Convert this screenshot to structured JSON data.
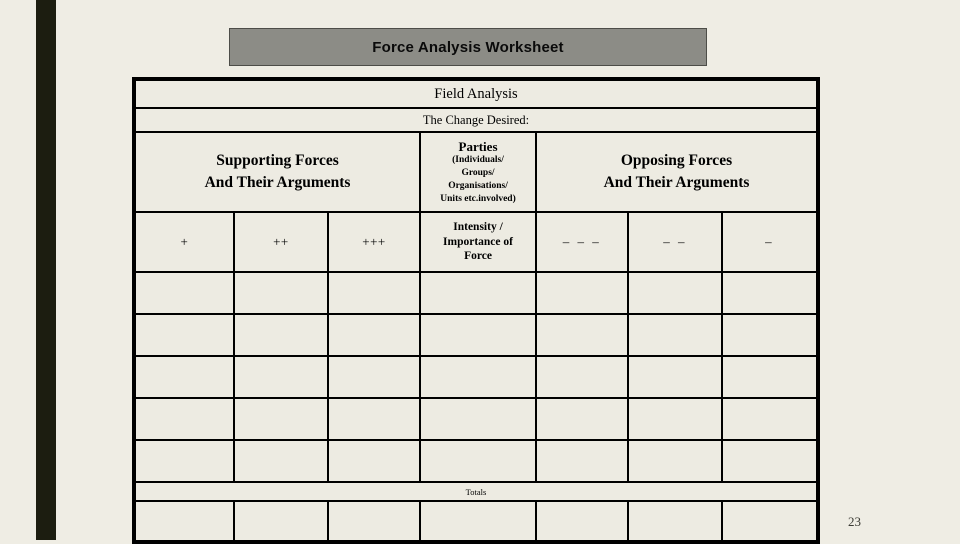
{
  "slide": {
    "title": "Force Analysis Worksheet",
    "page_number": "23",
    "colors": {
      "background": "#EFEDE4",
      "accent_bar": "#1C1D10",
      "title_plaque": "#8C8C86",
      "cell_fill": "#EDEBE2",
      "border": "#000000"
    }
  },
  "worksheet": {
    "banner": "Field Analysis",
    "change_desired_label": "The Change Desired:",
    "group_headers": {
      "supporting": "Supporting Forces\nAnd Their Arguments",
      "supporting_line1": "Supporting Forces",
      "supporting_line2": "And Their Arguments",
      "parties_title": "Parties",
      "parties_sub_line1": "(Individuals/",
      "parties_sub_line2": "Groups/",
      "parties_sub_line3": "Organisations/",
      "parties_sub_line4": "Units etc.involved)",
      "opposing_line1": "Opposing Forces",
      "opposing_line2": "And Their Arguments"
    },
    "scale_row": {
      "supporting": [
        "+",
        "++",
        "+++"
      ],
      "intensity_line1": "Intensity /",
      "intensity_line2": "Importance of",
      "intensity_line3": "Force",
      "opposing": [
        "– – –",
        "– –",
        "–"
      ]
    },
    "body_rows": [
      [
        "",
        "",
        "",
        "",
        "",
        "",
        ""
      ],
      [
        "",
        "",
        "",
        "",
        "",
        "",
        ""
      ],
      [
        "",
        "",
        "",
        "",
        "",
        "",
        ""
      ],
      [
        "",
        "",
        "",
        "",
        "",
        "",
        ""
      ],
      [
        "",
        "",
        "",
        "",
        "",
        "",
        ""
      ]
    ],
    "totals_label": "Totals",
    "totals_row": [
      "",
      "",
      "",
      "",
      "",
      "",
      ""
    ]
  }
}
